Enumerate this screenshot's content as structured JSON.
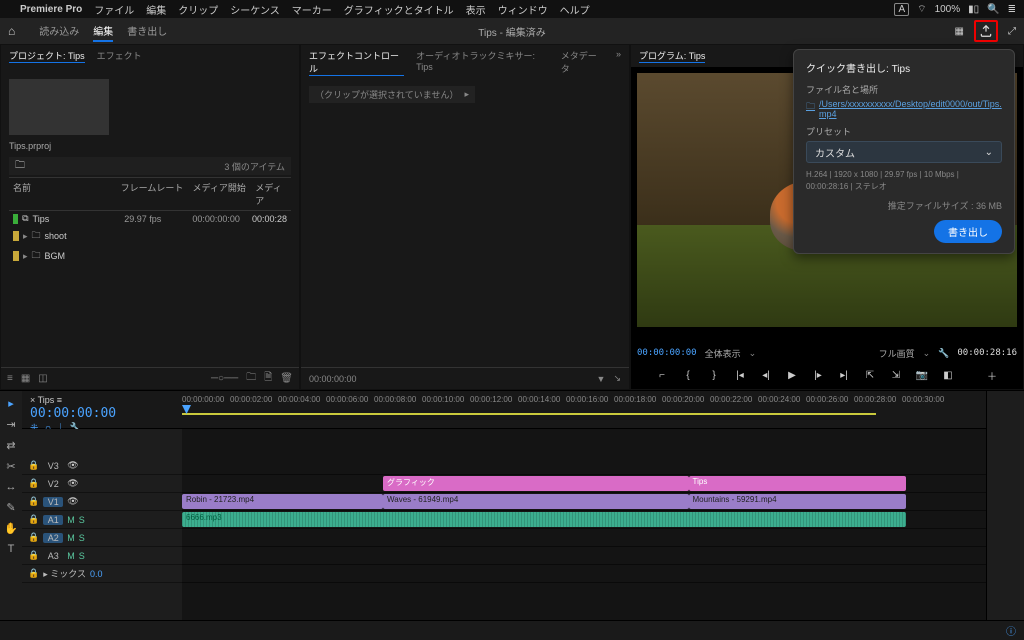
{
  "mac": {
    "app": "Premiere Pro",
    "menus": [
      "ファイル",
      "編集",
      "クリップ",
      "シーケンス",
      "マーカー",
      "グラフィックとタイトル",
      "表示",
      "ウィンドウ",
      "ヘルプ"
    ],
    "right": {
      "wifi": "100%",
      "input": "A"
    }
  },
  "header": {
    "tabs": [
      "読み込み",
      "編集",
      "書き出し"
    ],
    "active_tab": 1,
    "doc_title": "Tips - 編集済み"
  },
  "project_panel": {
    "tabs": [
      "プロジェクト: Tips",
      "エフェクト"
    ],
    "active": 0,
    "file": "Tips.prproj",
    "item_count": "3 個のアイテム",
    "cols": [
      "名前",
      "フレームレート",
      "メディア開始",
      "メディア"
    ],
    "rows": [
      {
        "tag": "#3aae3a",
        "name": "Tips",
        "icon": "seq",
        "fps": "29.97 fps",
        "start": "00:00:00:00",
        "end": "00:00:28"
      },
      {
        "tag": "#c9a93a",
        "name": "shoot",
        "icon": "bin",
        "fps": "",
        "start": "",
        "end": ""
      },
      {
        "tag": "#c9a93a",
        "name": "BGM",
        "icon": "bin",
        "fps": "",
        "start": "",
        "end": ""
      }
    ]
  },
  "effect_controls": {
    "tabs": [
      "エフェクトコントロール",
      "オーディオトラックミキサー: Tips",
      "メタデータ"
    ],
    "active": 0,
    "empty": "（クリップが選択されていません）",
    "tc": "00:00:00:00"
  },
  "program": {
    "tab": "プログラム: Tips",
    "tc_in": "00:00:00:00",
    "fit": "全体表示",
    "quality": "フル画質",
    "tc_out": "00:00:28:16"
  },
  "quick_export": {
    "title_prefix": "クイック書き出し:",
    "title_seq": "Tips",
    "file_label": "ファイル名と場所",
    "path": "/Users/xxxxxxxxxx/Desktop/edit0000/out/Tips.mp4",
    "preset_label": "プリセット",
    "preset": "カスタム",
    "meta": "H.264 | 1920 x 1080 | 29.97 fps | 10 Mbps | 00:00:28:16 | ステレオ",
    "est_label": "推定ファイルサイズ :",
    "est_size": "36 MB",
    "button": "書き出し"
  },
  "timeline": {
    "seq": "Tips",
    "tc": "00:00:00:00",
    "ruler": [
      "00:00:00:00",
      "00:00:02:00",
      "00:00:04:00",
      "00:00:06:00",
      "00:00:08:00",
      "00:00:10:00",
      "00:00:12:00",
      "00:00:14:00",
      "00:00:16:00",
      "00:00:18:00",
      "00:00:20:00",
      "00:00:22:00",
      "00:00:24:00",
      "00:00:26:00",
      "00:00:28:00",
      "00:00:30:00"
    ],
    "tracks": {
      "v3": "V3",
      "v2": "V2",
      "v1": "V1",
      "a1": "A1",
      "a2": "A2",
      "a3": "A3",
      "mix": "ミックス",
      "mix_val": "0.0"
    },
    "clips": {
      "v2a": "グラフィック",
      "v2b": "Tips",
      "v1a": "Robin - 21723.mp4",
      "v1b": "Waves - 61949.mp4",
      "v1c": "Mountains - 59291.mp4",
      "a1": "6666.mp3"
    }
  }
}
